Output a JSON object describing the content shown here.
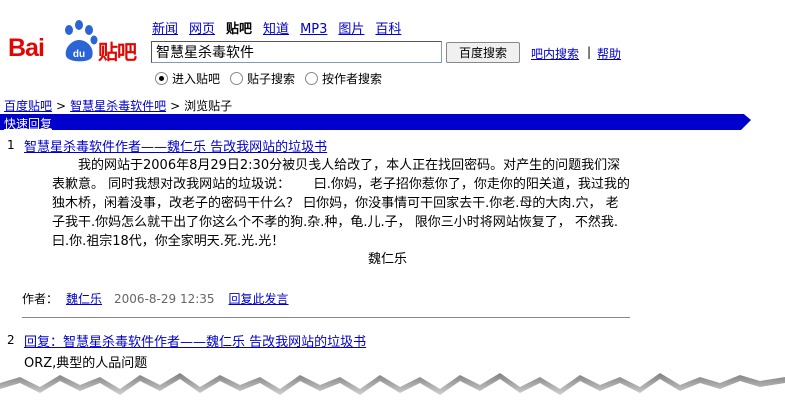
{
  "logo": {
    "text": "Bai",
    "du": "du",
    "tieba": "贴吧",
    "brand_color": "#e10602"
  },
  "nav": {
    "items": [
      "新闻",
      "网页",
      "贴吧",
      "知道",
      "MP3",
      "图片",
      "百科"
    ],
    "current": "贴吧"
  },
  "search": {
    "value": "智慧星杀毒软件",
    "button": "百度搜索",
    "inbar_link": "吧内搜索",
    "separator": "|",
    "help": "帮助",
    "radios": [
      "进入贴吧",
      "贴子搜索",
      "按作者搜索"
    ],
    "selected_radio": "进入贴吧"
  },
  "breadcrumb": {
    "root": "百度贴吧",
    "sep": ">",
    "forum": "智慧星杀毒软件吧",
    "current": "浏览贴子"
  },
  "quick_reply": "快速回复",
  "accent_color": "#0000cc",
  "posts": [
    {
      "num": "1",
      "title": "智慧星杀毒软件作者——魏仁乐 告改我网站的垃圾书",
      "body": "我的网站于2006年8月29日2:30分被贝戋人给改了，本人正在找回密码。对产生的问题我们深表歉意。 同时我想对改我网站的垃圾说：　　 曰.你妈，老子招你惹你了，你走你的阳关道，我过我的独木桥，闲着没事，改老子的密码干什么？ 曰你妈，你没事情可干回家去干.你老.母的大肉.穴， 老子我干.你妈怎么就干出了你这么个不孝的狗.杂.种，龟.儿.子， 限你三小时将网站恢复了， 不然我.曰.你.祖宗18代，你全家明天.死.光.光！",
      "signature": "魏仁乐",
      "author_label": "作者：",
      "author": "魏仁乐",
      "time": "2006-8-29 12:35",
      "reply_link": "回复此发言"
    },
    {
      "num": "2",
      "title": "回复：智慧星杀毒软件作者——魏仁乐 告改我网站的垃圾书",
      "body": "ORZ,典型的人品问题"
    }
  ]
}
